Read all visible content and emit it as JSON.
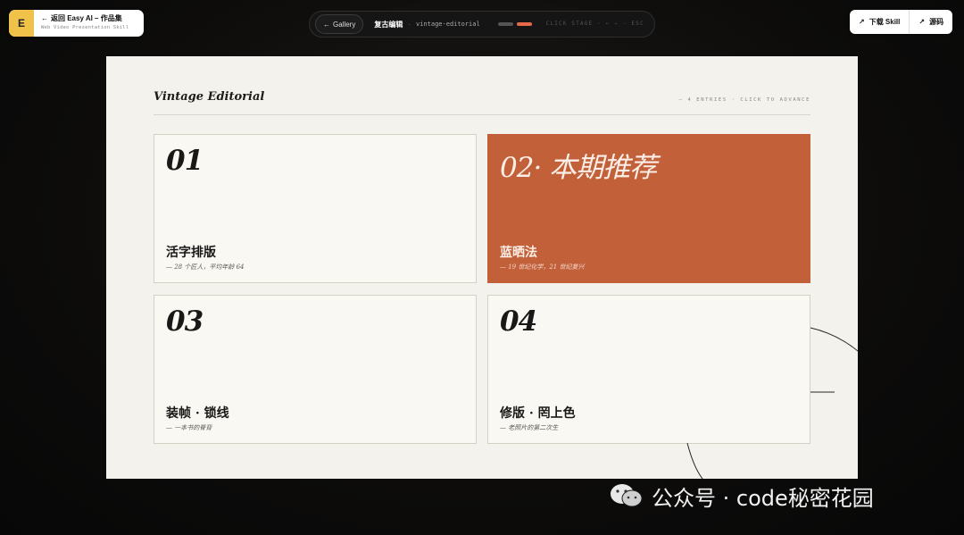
{
  "brand": {
    "logo_letter": "E",
    "back_label": "返回 Easy AI – 作品集",
    "subtitle": "Web Video Presentation Skill"
  },
  "toolbar": {
    "gallery_label": "Gallery",
    "title": "复古编辑",
    "separator": "·",
    "slug": "vintage-editorial",
    "progress": {
      "current": 2,
      "total": 2
    },
    "hint": "CLICK STAGE · ← → · ESC"
  },
  "actions": {
    "download_label": "下载 Skill",
    "source_label": "源码"
  },
  "slide": {
    "masthead": "Vintage Editorial",
    "meta": "— 4 ENTRIES · CLICK TO ADVANCE",
    "cards": [
      {
        "number": "01",
        "title": "活字排版",
        "subtitle": "— 28 个匠人，平均年龄 64",
        "featured": false
      },
      {
        "number": "02· 本期推荐",
        "title": "蓝晒法",
        "subtitle": "— 19 世纪化学，21 世纪复兴",
        "featured": true
      },
      {
        "number": "03",
        "title": "装帧 · 锁线",
        "subtitle": "— 一本书的脊背",
        "featured": false
      },
      {
        "number": "04",
        "title": "修版 · 罔上色",
        "subtitle": "— 老照片的第二次生",
        "featured": false
      }
    ]
  },
  "watermark": {
    "text": "公众号 · code秘密花园",
    "icon": "wechat-icon"
  },
  "colors": {
    "accent": "#c2603a",
    "paper": "#f4f2ec",
    "brand_yellow": "#f0c24a",
    "progress_on": "#e8694a"
  }
}
